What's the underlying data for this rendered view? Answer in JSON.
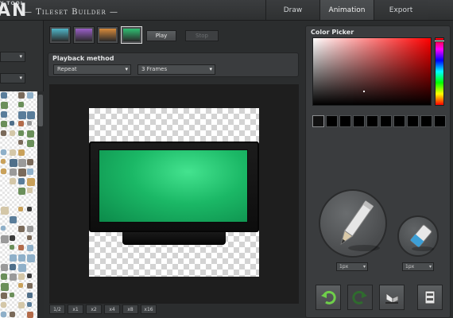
{
  "app": {
    "logo_small": "Y TOOL",
    "logo_big": "AN",
    "subtitle": "— Tileset Builder —"
  },
  "tabs": [
    {
      "label": "Draw",
      "active": false
    },
    {
      "label": "Animation",
      "active": true
    },
    {
      "label": "Export",
      "active": false
    }
  ],
  "frames": [
    {
      "color": "#4fb6c9"
    },
    {
      "color": "#9b5fc9"
    },
    {
      "color": "#d78a3b"
    },
    {
      "color": "#2fbf72",
      "selected": true
    }
  ],
  "controls": {
    "play_label": "Play",
    "stop_label": "Stop"
  },
  "playback": {
    "label": "Playback method",
    "method": "Repeat",
    "frames": "3 Frames"
  },
  "zoom_levels": [
    "1/2",
    "x1",
    "x2",
    "x4",
    "x8",
    "x16"
  ],
  "color_picker": {
    "label": "Color Picker",
    "swatch_count": 9
  },
  "brush": {
    "pencil_size": "1px",
    "eraser_size": "1px"
  },
  "icons": {
    "pencil": "pencil-icon",
    "eraser": "eraser-icon",
    "undo": "undo-icon",
    "redo": "redo-icon",
    "fill": "fill-icon",
    "panel": "panel-icon"
  }
}
